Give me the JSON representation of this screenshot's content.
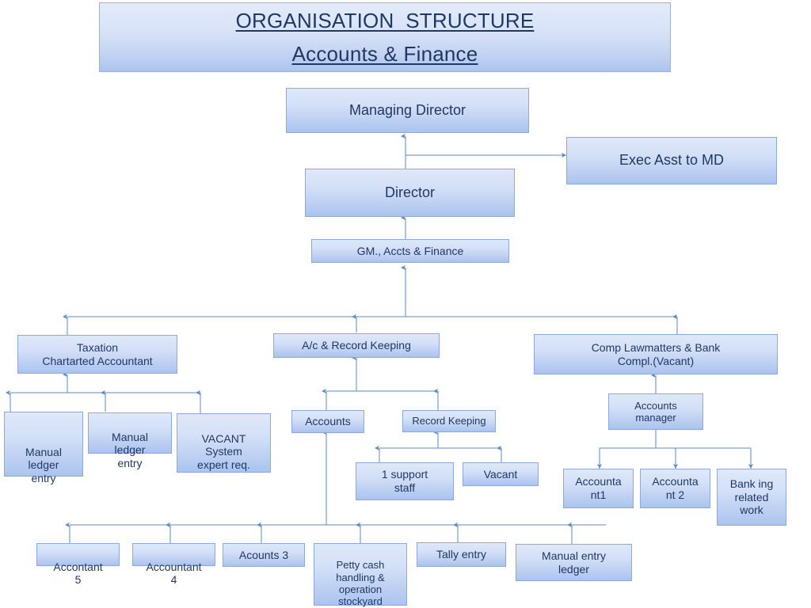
{
  "title": {
    "line1": "ORGANISATION  STRUCTURE",
    "line2": "Accounts & Finance"
  },
  "colors": {
    "box_fill_top": "#dfe8fa",
    "box_fill_bottom": "#aac4ee",
    "box_border": "#8eaadb",
    "text": "#203864",
    "title_text": "#1f3864",
    "connector": "#5b8ac4",
    "background": "#ffffff"
  },
  "nodes": {
    "managing_director": "Managing Director",
    "exec_asst": "Exec Asst to MD",
    "director": "Director",
    "gm": "GM., Accts & Finance",
    "taxation_line1": "Taxation",
    "taxation_line2": "Chartarted Accountant",
    "ac_record_keeping": "A/c & Record Keeping",
    "comp_law_line1": "Comp Lawmatters & Bank",
    "comp_law_line2": "Compl.(Vacant)",
    "manual_ledger_entry_1": "Manual\nledger\nentry",
    "manual_ledger_entry_2": "Manual\nledger\nentry",
    "vacant_system_expert": "VACANT\nSystem\nexpert req.",
    "accounts": "Accounts",
    "record_keeping": "Record Keeping",
    "support_staff": "1 support\nstaff",
    "vacant": "Vacant",
    "accounts_manager": "Accounts\nmanager",
    "accountant_1": "Accounta\nnt1",
    "accountant_2": "Accounta\nnt 2",
    "banking_related_work": "Bank ing\nrelated\nwork",
    "accontant_5": "Accontant\n5",
    "accountant_4": "Accountant\n4",
    "acounts_3": "Acounts 3",
    "petty_cash": "Petty cash\nhandling &\noperation\nstockyard",
    "tally_entry": "Tally entry",
    "manual_entry_ledger": "Manual entry\nledger"
  }
}
